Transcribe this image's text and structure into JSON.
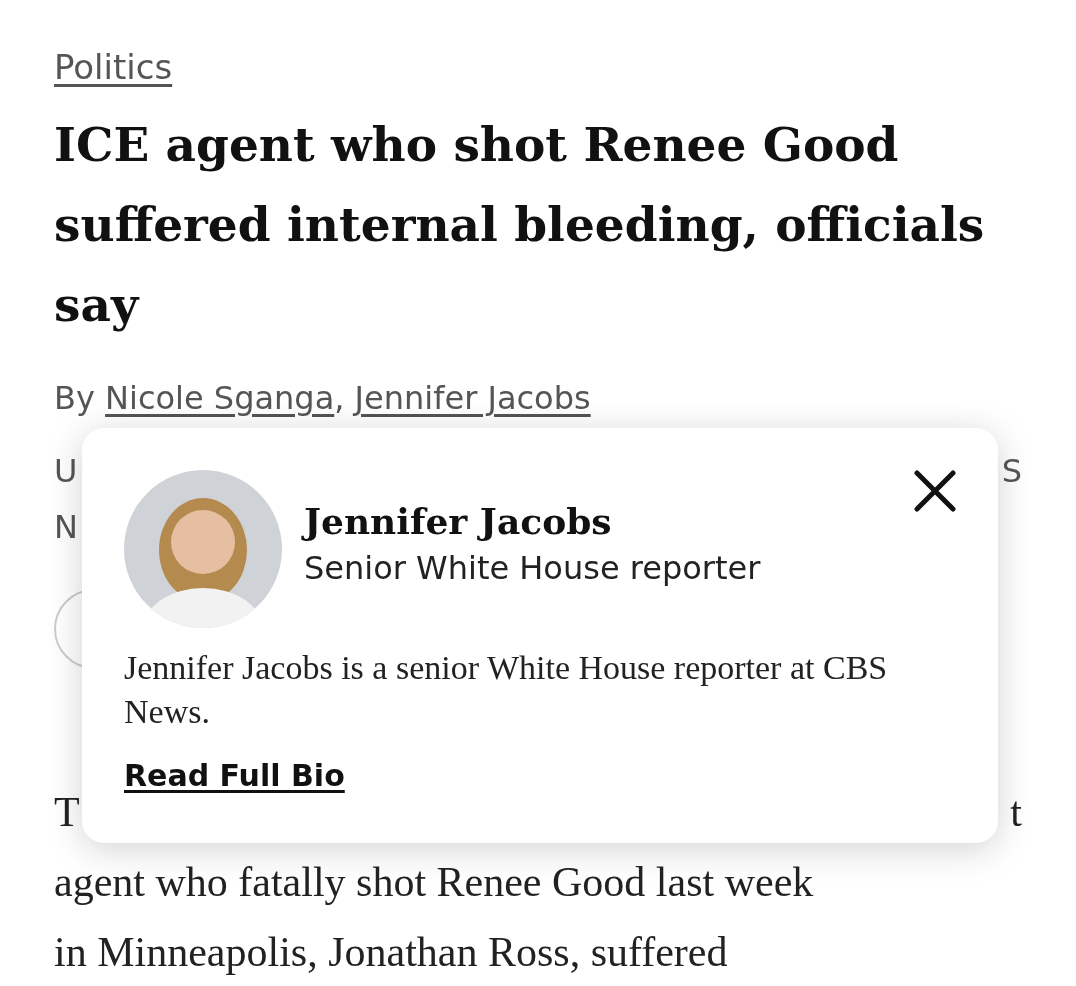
{
  "section_link": "Politics",
  "headline": "ICE agent who shot Renee Good suffered internal bleeding, officials say",
  "byline": {
    "prefix": "By",
    "separator": ",",
    "authors": [
      "Nicole Sganga",
      "Jennifer Jacobs"
    ]
  },
  "covered_rows": [
    {
      "left": "U",
      "right": "S"
    },
    {
      "left": "N"
    }
  ],
  "body": {
    "first_line": {
      "left": "T",
      "right": "t"
    },
    "lines": [
      "agent who fatally shot Renee Good last week",
      "in Minneapolis, Jonathan Ross, suffered"
    ]
  },
  "author_popup": {
    "name": "Jennifer Jacobs",
    "role": "Senior White House reporter",
    "bio": "Jennifer Jacobs is a senior White House reporter at CBS News.",
    "link": "Read Full Bio"
  }
}
